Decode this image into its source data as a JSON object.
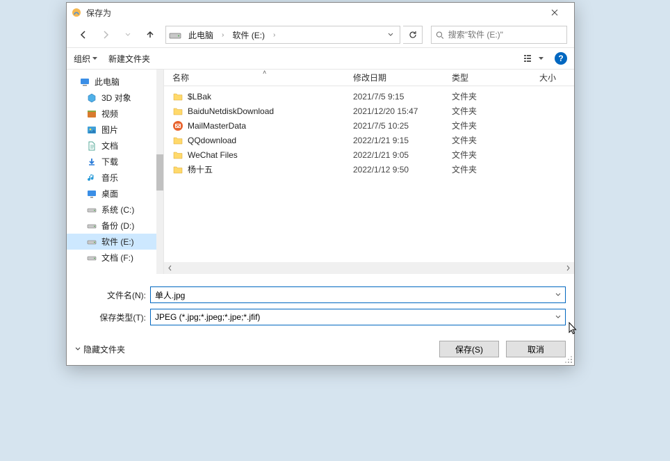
{
  "title": "保存为",
  "breadcrumb": {
    "root": "此电脑",
    "current": "软件 (E:)"
  },
  "search": {
    "placeholder": "搜索\"软件 (E:)\""
  },
  "toolbar": {
    "organize": "组织",
    "newfolder": "新建文件夹",
    "help": "?"
  },
  "columns": {
    "name": "名称",
    "date": "修改日期",
    "type": "类型",
    "size": "大小"
  },
  "sidebar": {
    "root": "此电脑",
    "items": [
      {
        "label": "3D 对象"
      },
      {
        "label": "视频"
      },
      {
        "label": "图片"
      },
      {
        "label": "文档"
      },
      {
        "label": "下载"
      },
      {
        "label": "音乐"
      },
      {
        "label": "桌面"
      },
      {
        "label": "系统 (C:)"
      },
      {
        "label": "备份 (D:)"
      },
      {
        "label": "软件 (E:)",
        "selected": true
      },
      {
        "label": "文档 (F:)"
      }
    ]
  },
  "files": [
    {
      "name": "$LBak",
      "date": "2021/7/5 9:15",
      "type": "文件夹"
    },
    {
      "name": "BaiduNetdiskDownload",
      "date": "2021/12/20 15:47",
      "type": "文件夹"
    },
    {
      "name": "MailMasterData",
      "date": "2021/7/5 10:25",
      "type": "文件夹",
      "icon": "mail"
    },
    {
      "name": "QQdownload",
      "date": "2022/1/21 9:15",
      "type": "文件夹"
    },
    {
      "name": "WeChat Files",
      "date": "2022/1/21 9:05",
      "type": "文件夹"
    },
    {
      "name": "杨十五",
      "date": "2022/1/12 9:50",
      "type": "文件夹"
    }
  ],
  "form": {
    "filename_label": "文件名(N):",
    "filename_value": "单人.jpg",
    "filetype_label": "保存类型(T):",
    "filetype_value": "JPEG (*.jpg;*.jpeg;*.jpe;*.jfif)"
  },
  "footer": {
    "hide": "隐藏文件夹",
    "save": "保存(S)",
    "cancel": "取消"
  }
}
